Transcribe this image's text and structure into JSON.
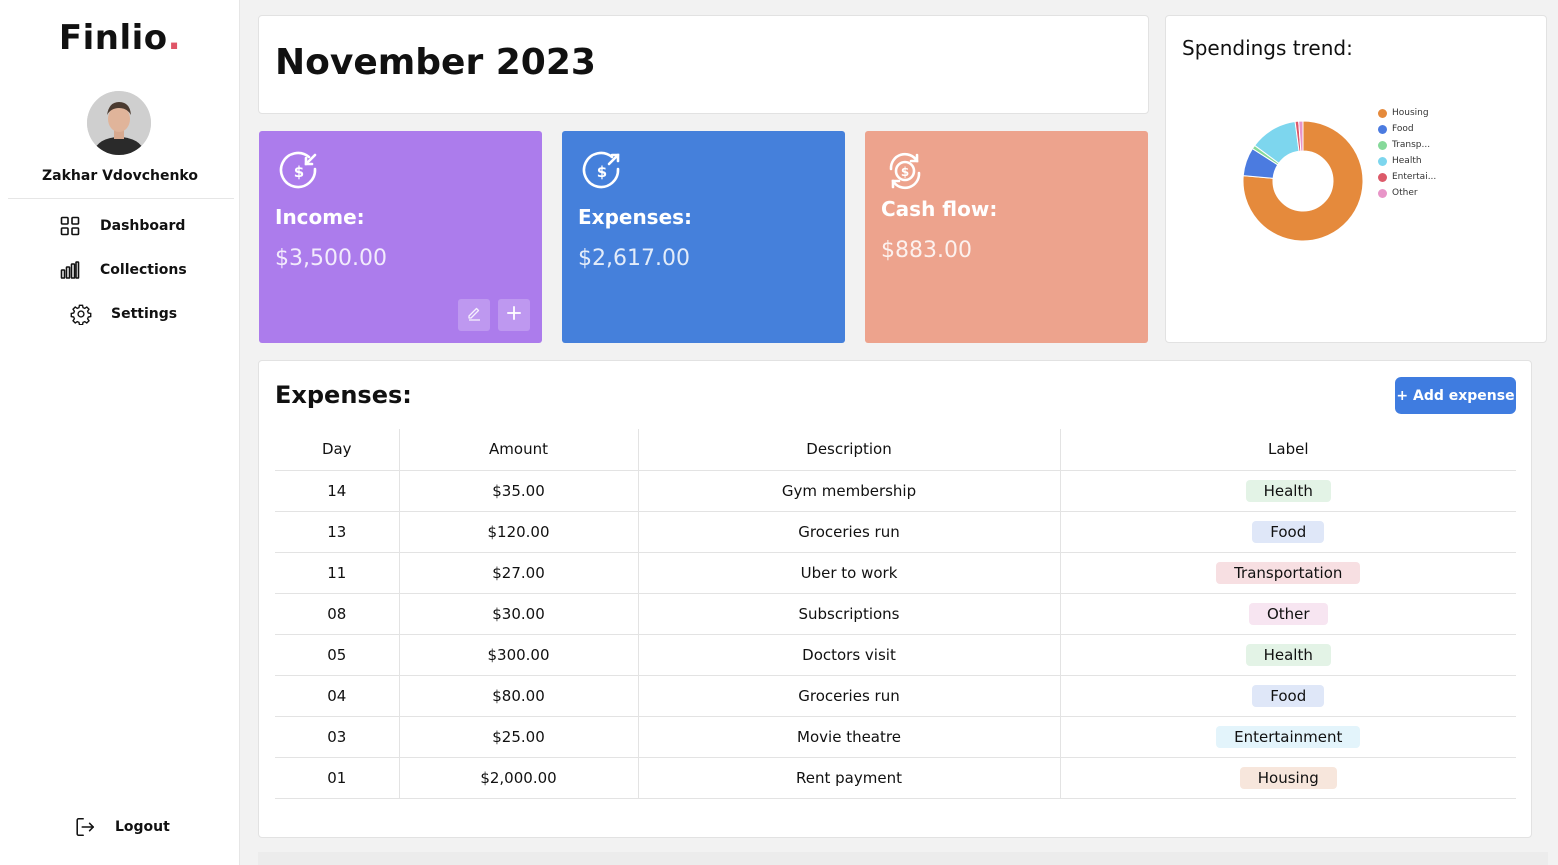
{
  "app": {
    "logo_text": "Finlio",
    "logo_dot": ".",
    "accent_color": "#e05567"
  },
  "sidebar": {
    "username": "Zakhar Vdovchenko",
    "items": [
      {
        "label": "Dashboard",
        "icon": "grid-icon"
      },
      {
        "label": "Collections",
        "icon": "bar-chart-icon"
      },
      {
        "label": "Settings",
        "icon": "gear-icon"
      }
    ],
    "logout": {
      "label": "Logout",
      "icon": "logout-icon"
    }
  },
  "header": {
    "month": "November 2023"
  },
  "stats": {
    "income": {
      "label": "Income:",
      "value": "$3,500.00",
      "color": "#ac7cec",
      "icon": "dollar-in-icon"
    },
    "expenses": {
      "label": "Expenses:",
      "value": "$2,617.00",
      "color": "#4580db",
      "icon": "dollar-out-icon"
    },
    "cashflow": {
      "label": "Cash flow:",
      "value": "$883.00",
      "color": "#eda38d",
      "icon": "dollar-cycle-icon"
    }
  },
  "trend": {
    "title": "Spendings trend:"
  },
  "chart_data": {
    "type": "pie",
    "categories": [
      "Housing",
      "Food",
      "Transp...",
      "Health",
      "Entertai...",
      "Other"
    ],
    "values": [
      2000,
      200,
      27,
      335,
      25,
      30
    ],
    "colors": [
      "#e58a3c",
      "#4b7be0",
      "#86d99a",
      "#7dd6ee",
      "#dc5a6a",
      "#e895c8"
    ],
    "legend_position": "right"
  },
  "expenses_table": {
    "title": "Expenses:",
    "add_button": "+ Add expense",
    "columns": [
      "Day",
      "Amount",
      "Description",
      "Label"
    ],
    "rows": [
      {
        "day": "14",
        "amount": "$35.00",
        "description": "Gym membership",
        "label": "Health"
      },
      {
        "day": "13",
        "amount": "$120.00",
        "description": "Groceries run",
        "label": "Food"
      },
      {
        "day": "11",
        "amount": "$27.00",
        "description": "Uber to work",
        "label": "Transportation"
      },
      {
        "day": "08",
        "amount": "$30.00",
        "description": "Subscriptions",
        "label": "Other"
      },
      {
        "day": "05",
        "amount": "$300.00",
        "description": "Doctors visit",
        "label": "Health"
      },
      {
        "day": "04",
        "amount": "$80.00",
        "description": "Groceries run",
        "label": "Food"
      },
      {
        "day": "03",
        "amount": "$25.00",
        "description": "Movie theatre",
        "label": "Entertainment"
      },
      {
        "day": "01",
        "amount": "$2,000.00",
        "description": "Rent payment",
        "label": "Housing"
      }
    ],
    "label_colors": {
      "Health": "#e3f3e6",
      "Food": "#dfe7f8",
      "Transportation": "#f7dfe2",
      "Other": "#f7e5f1",
      "Entertainment": "#e3f4fb",
      "Housing": "#f7e6dc"
    }
  }
}
